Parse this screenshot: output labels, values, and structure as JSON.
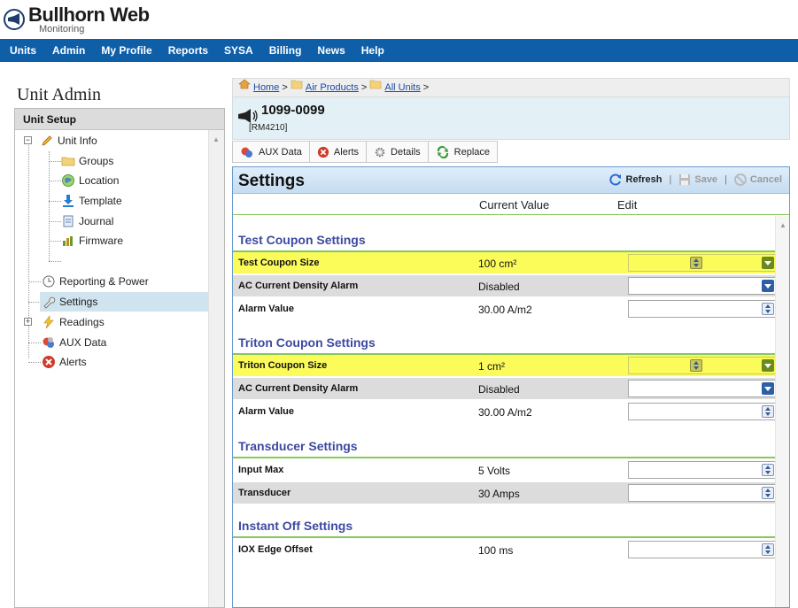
{
  "app": {
    "title": "Bullhorn Web",
    "subtitle": "Monitoring"
  },
  "nav": [
    "Units",
    "Admin",
    "My Profile",
    "Reports",
    "SYSA",
    "Billing",
    "News",
    "Help"
  ],
  "left": {
    "title": "Unit Admin",
    "panel_title": "Unit Setup",
    "tree": [
      "Unit Info",
      "Groups",
      "Location",
      "Template",
      "Journal",
      "Firmware",
      "Reporting & Power",
      "Settings",
      "Readings",
      "AUX Data",
      "Alerts"
    ]
  },
  "breadcrumb": [
    "Home",
    "Air Products",
    "All Units"
  ],
  "breadcrumb_sep": ">",
  "unit": {
    "id": "1099-0099",
    "model": "[RM4210]"
  },
  "tabs": [
    "AUX Data",
    "Alerts",
    "Details",
    "Replace"
  ],
  "settings": {
    "title": "Settings",
    "refresh": "Refresh",
    "save": "Save",
    "cancel": "Cancel",
    "col_current": "Current Value",
    "col_edit": "Edit",
    "sections": [
      {
        "title": "Test Coupon Settings",
        "rows": [
          {
            "label": "Test Coupon Size",
            "value": "100 cm²",
            "highlight": true,
            "control": "dropdown-spin"
          },
          {
            "label": "AC Current Density Alarm",
            "value": "Disabled",
            "highlight": false,
            "control": "dropdown"
          },
          {
            "label": "Alarm Value",
            "value": "30.00 A/m2",
            "highlight": false,
            "control": "spin"
          }
        ]
      },
      {
        "title": "Triton Coupon Settings",
        "rows": [
          {
            "label": "Triton Coupon Size",
            "value": "1 cm²",
            "highlight": true,
            "control": "dropdown-spin"
          },
          {
            "label": "AC Current Density Alarm",
            "value": "Disabled",
            "highlight": false,
            "control": "dropdown"
          },
          {
            "label": "Alarm Value",
            "value": "30.00 A/m2",
            "highlight": false,
            "control": "spin"
          }
        ]
      },
      {
        "title": "Transducer Settings",
        "rows": [
          {
            "label": "Input Max",
            "value": "5 Volts",
            "highlight": false,
            "control": "spin"
          },
          {
            "label": "Transducer",
            "value": "30 Amps",
            "highlight": false,
            "control": "spin"
          }
        ]
      },
      {
        "title": "Instant Off Settings",
        "rows": [
          {
            "label": "IOX Edge Offset",
            "value": "100 ms",
            "highlight": false,
            "control": "spin"
          }
        ]
      }
    ]
  },
  "colors": {
    "nav": "#0f5fa8",
    "section": "#3c4aa0",
    "accent_line": "#86c85a",
    "highlight": "#fbfb5a"
  }
}
